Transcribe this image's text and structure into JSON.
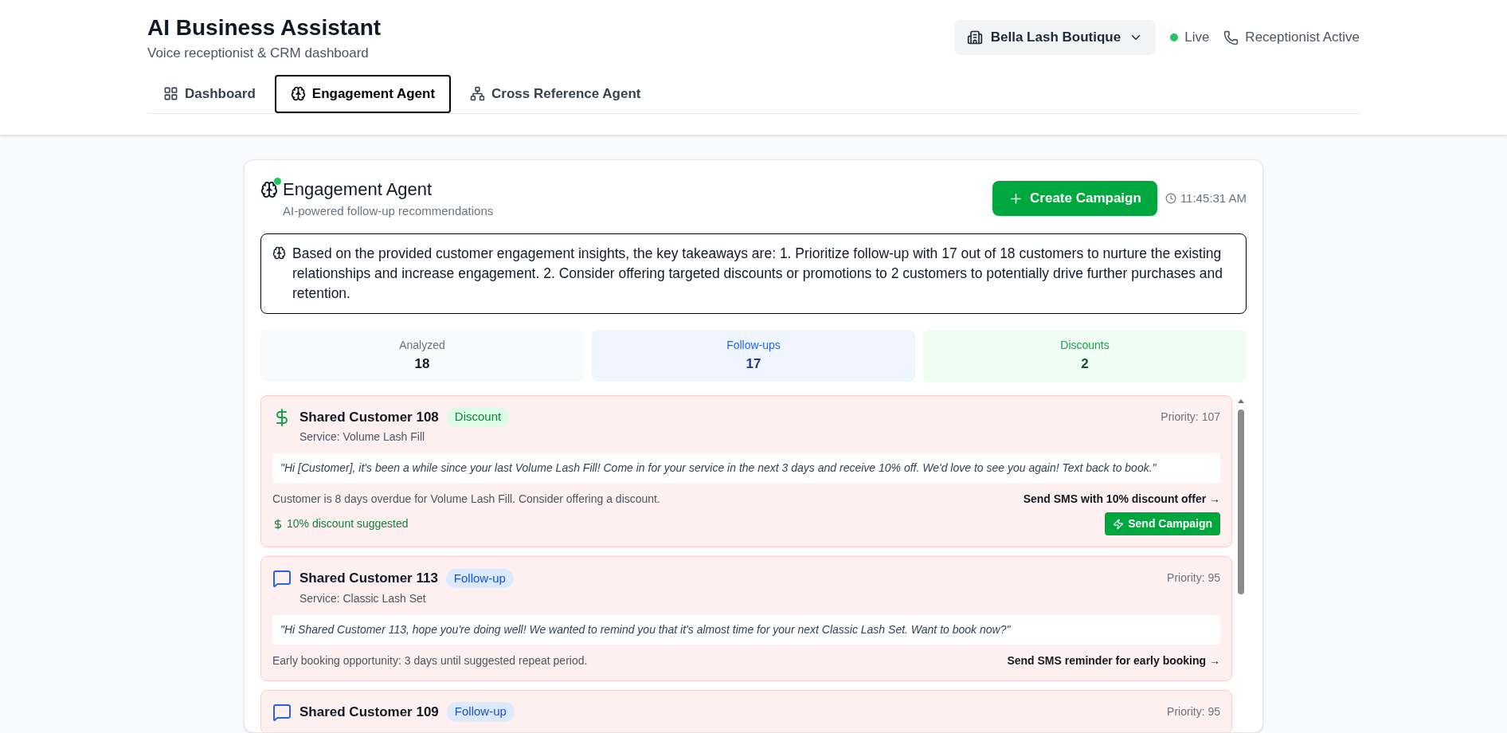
{
  "header": {
    "title": "AI Business Assistant",
    "subtitle": "Voice receptionist & CRM dashboard",
    "business": "Bella Lash Boutique",
    "live": {
      "on": true,
      "label": "Live"
    },
    "receptionist": "Receptionist Active"
  },
  "tabs": [
    {
      "label": "Dashboard",
      "selected": false
    },
    {
      "label": "Engagement Agent",
      "selected": true
    },
    {
      "label": "Cross Reference Agent",
      "selected": false
    }
  ],
  "agent": {
    "title": "Engagement Agent",
    "online": true,
    "subtitle": "AI-powered follow-up recommendations",
    "create_button": "Create Campaign",
    "time": "11:45:31 AM",
    "insight": "Based on the provided customer engagement insights, the key takeaways are: 1. Prioritize follow-up with 17 out of 18 customers to nurture the existing relationships and increase engagement. 2. Consider offering targeted discounts or promotions to 2 customers to potentially drive further purchases and retention.",
    "stats": [
      {
        "label": "Analyzed",
        "value": "18",
        "kind": "neutral"
      },
      {
        "label": "Follow-ups",
        "value": "17",
        "kind": "followup"
      },
      {
        "label": "Discounts",
        "value": "2",
        "kind": "discount"
      }
    ],
    "customers": [
      {
        "kind": "discount",
        "name": "Shared Customer 108",
        "badge": "Discount",
        "service": "Service: Volume Lash Fill",
        "priority": "Priority: 107",
        "message": "\"Hi [Customer], it's been a while since your last Volume Lash Fill! Come in for your service in the next 3 days and receive 10% off. We'd love to see you again! Text back to book.\"",
        "reason": "Customer is 8 days overdue for Volume Lash Fill. Consider offering a discount.",
        "action": "Send SMS with 10% discount offer →",
        "discount": "10% discount suggested",
        "send_button": "Send Campaign"
      },
      {
        "kind": "followup",
        "name": "Shared Customer 113",
        "badge": "Follow-up",
        "service": "Service: Classic Lash Set",
        "priority": "Priority: 95",
        "message": "\"Hi Shared Customer 113, hope you're doing well! We wanted to remind you that it's almost time for your next Classic Lash Set. Want to book now?\"",
        "reason": "Early booking opportunity: 3 days until suggested repeat period.",
        "action": "Send SMS reminder for early booking →"
      },
      {
        "kind": "followup",
        "name": "Shared Customer 109",
        "badge": "Follow-up",
        "priority": "Priority: 95"
      }
    ]
  }
}
